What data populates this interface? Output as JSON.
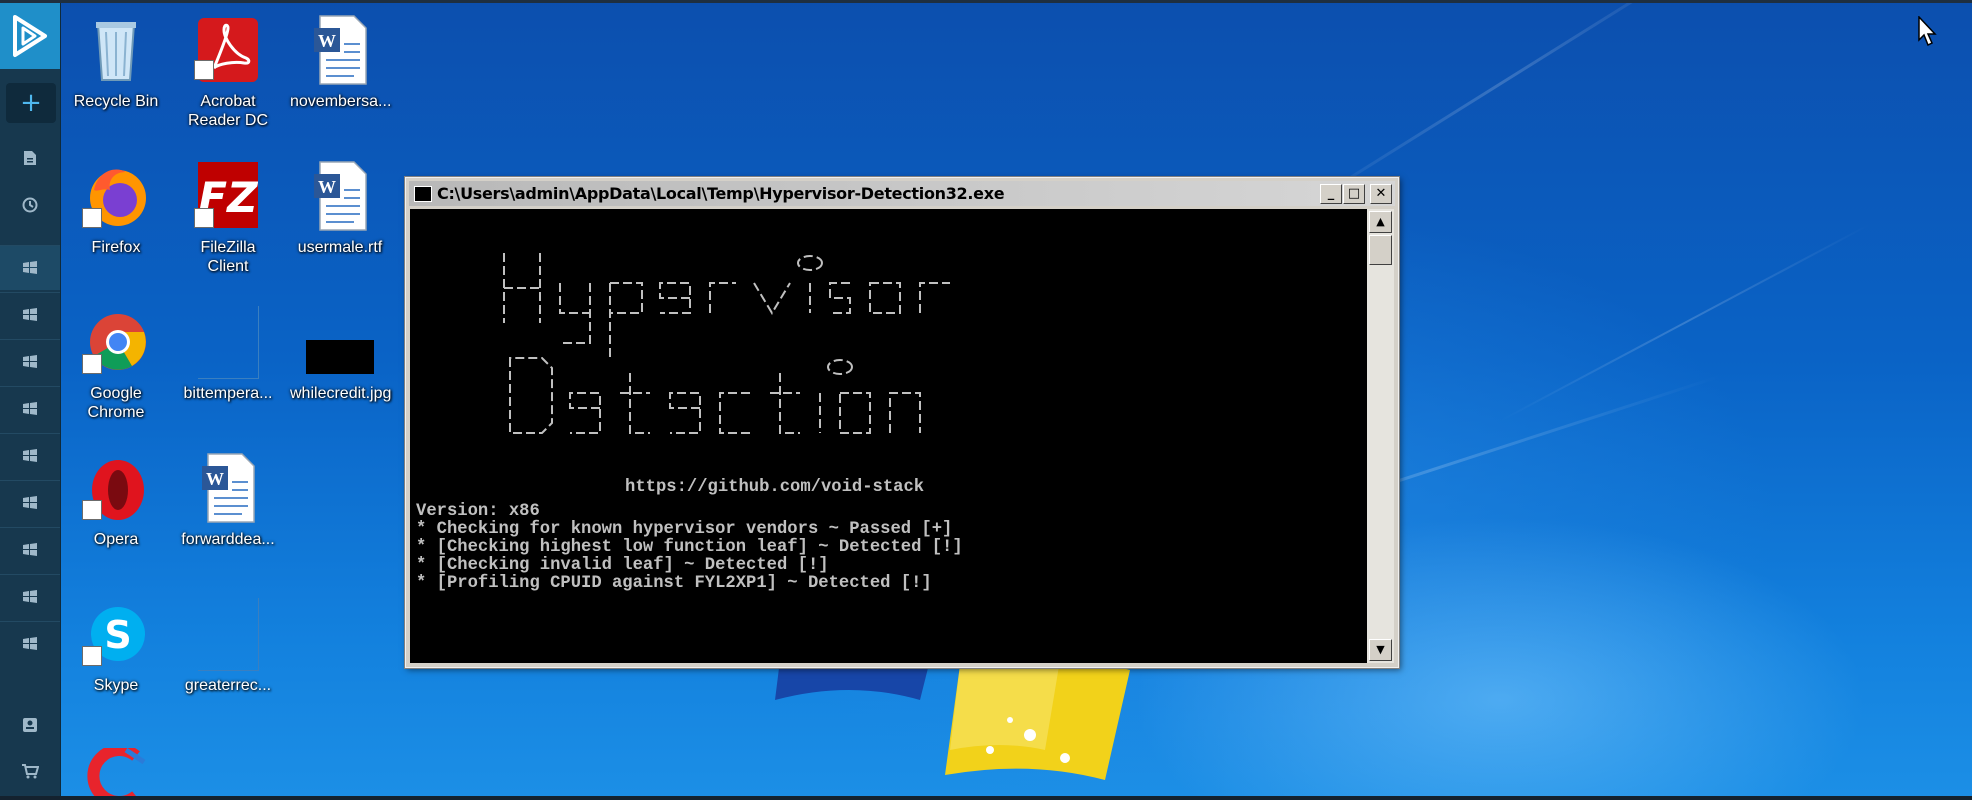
{
  "desktop": {
    "icons": [
      {
        "id": "recycle-bin",
        "label": "Recycle Bin"
      },
      {
        "id": "acrobat",
        "label": "Acrobat Reader DC"
      },
      {
        "id": "novembersa",
        "label": "novembersa..."
      },
      {
        "id": "firefox",
        "label": "Firefox"
      },
      {
        "id": "filezilla",
        "label": "FileZilla Client"
      },
      {
        "id": "usermale",
        "label": "usermale.rtf"
      },
      {
        "id": "chrome",
        "label": "Google Chrome"
      },
      {
        "id": "bittempera",
        "label": "bittempera..."
      },
      {
        "id": "whilecredit",
        "label": "whilecredit.jpg"
      },
      {
        "id": "opera",
        "label": "Opera"
      },
      {
        "id": "forwarddea",
        "label": "forwarddea..."
      },
      {
        "id": "skype",
        "label": "Skype"
      },
      {
        "id": "greaterrec",
        "label": "greaterrec..."
      }
    ]
  },
  "sidebar": {
    "add_label": "+",
    "items": [
      "file-icon",
      "history-icon",
      "windows-icon",
      "windows-icon",
      "windows-icon",
      "windows-icon",
      "windows-icon",
      "windows-icon",
      "windows-icon",
      "windows-icon",
      "windows-icon",
      "id-card-icon",
      "cart-icon"
    ]
  },
  "console": {
    "title": "C:\\Users\\admin\\AppData\\Local\\Temp\\Hypervisor-Detection32.exe",
    "ascii_art_words": [
      "Hypervisor",
      "Detection"
    ],
    "url": "https://github.com/void-stack",
    "lines": [
      "Version: x86",
      "* Checking for known hypervisor vendors ~ Passed [+]",
      "* [Checking highest low function leaf] ~ Detected [!]",
      "* [Checking invalid leaf] ~ Detected [!]",
      "* [Profiling CPUID against FYL2XP1] ~ Detected [!]"
    ],
    "minimize_glyph": "_",
    "maximize_glyph": "□",
    "close_glyph": "✕",
    "scroll_up_glyph": "▲",
    "scroll_down_glyph": "▼"
  },
  "colors": {
    "sidebar_bg": "#17384e",
    "sidebar_accent": "#1f8fc9",
    "console_bg": "#000000",
    "console_text": "#c0c0c0"
  }
}
